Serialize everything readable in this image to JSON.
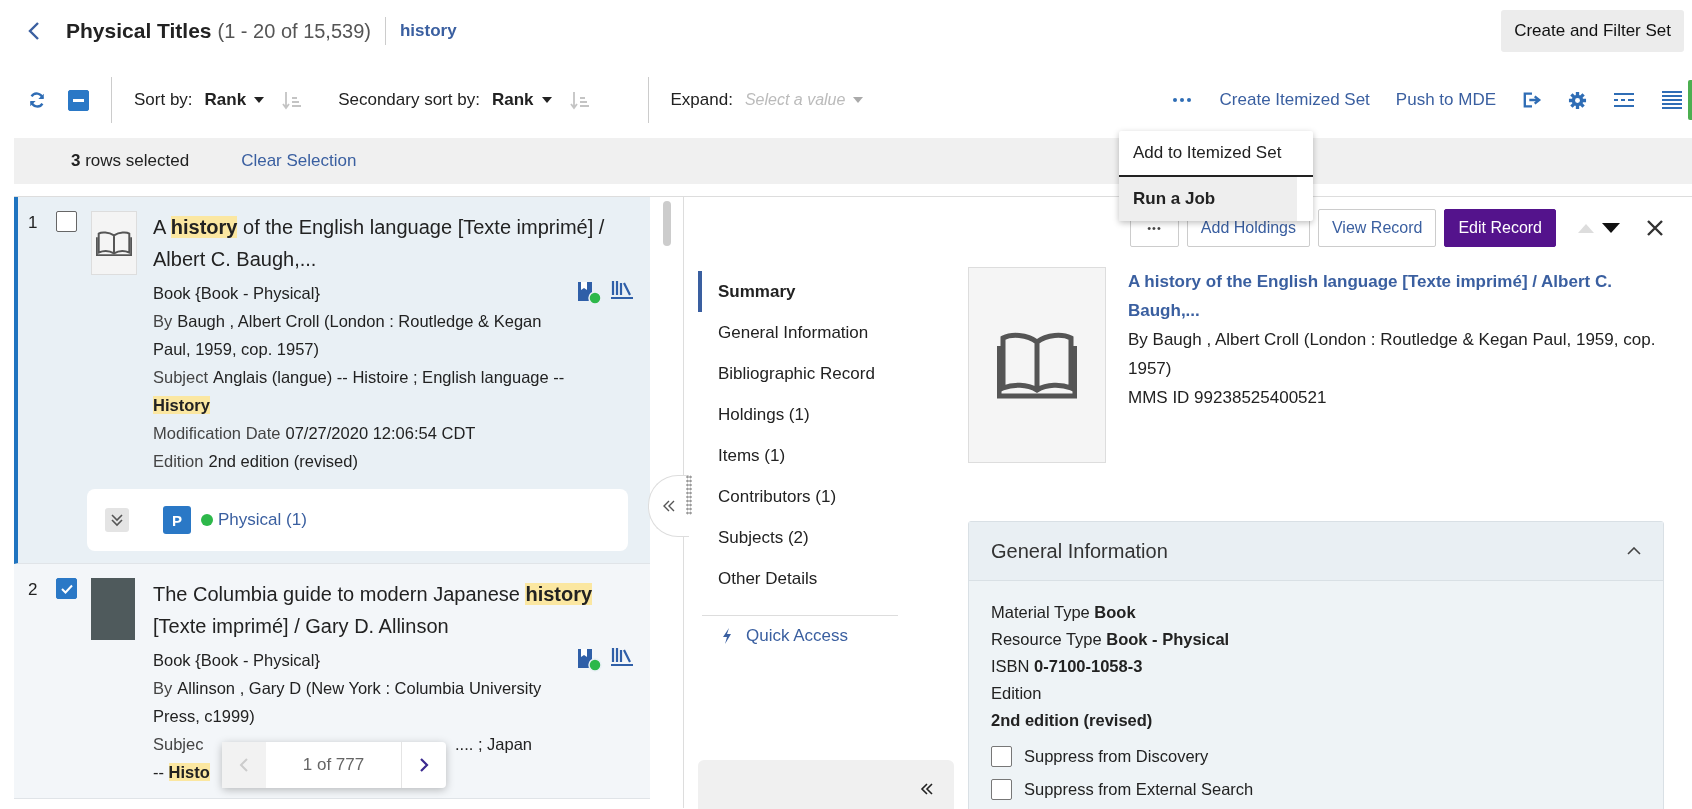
{
  "header": {
    "title": "Physical Titles",
    "count": "(1 - 20 of 15,539)",
    "query": "history",
    "button": "Create and Filter Set"
  },
  "toolbar": {
    "select_all": {
      "indeterminate": true
    },
    "sort": {
      "label": "Sort by:",
      "value": "Rank"
    },
    "secondary_sort": {
      "label": "Secondary sort by:",
      "value": "Rank"
    },
    "expand": {
      "label": "Expand:",
      "placeholder": "Select a value"
    },
    "actions": [
      "Create Itemized Set",
      "Push to MDE"
    ]
  },
  "selection": {
    "count": "3",
    "text": "rows selected",
    "clear": "Clear Selection"
  },
  "menu": [
    {
      "label": "Add to Itemized Set",
      "selected": false
    },
    {
      "label": "Run a Job",
      "selected": true
    }
  ],
  "results": [
    {
      "number": "1",
      "checked": false,
      "current": true,
      "thumbnail": {
        "kind": "icon"
      },
      "title": [
        {
          "text": "A ",
          "highlight": false
        },
        {
          "text": "history",
          "highlight": true
        },
        {
          "text": " of the English language [Texte imprimé] / Albert C. Baugh,...",
          "highlight": false
        }
      ],
      "format": "Book {Book - Physical}",
      "fields": [
        {
          "label": "By",
          "parts": [
            {
              "text": "Baugh , Albert Croll (London : Routledge & Kegan Paul, 1959, cop. 1957)",
              "highlight": false
            }
          ]
        },
        {
          "label": "Subject",
          "parts": [
            {
              "text": "Anglais (langue) -- Histoire ; English language -- ",
              "highlight": false
            },
            {
              "text": "History",
              "highlight": true
            }
          ]
        },
        {
          "label": "Modification Date",
          "parts": [
            {
              "text": "07/27/2020 12:06:54 CDT",
              "highlight": false
            }
          ]
        },
        {
          "label": "Edition",
          "parts": [
            {
              "text": "2nd edition (revised)",
              "highlight": false
            }
          ]
        }
      ],
      "holdings": {
        "badge": "P",
        "link": "Physical (1)",
        "color": "#2db84a"
      }
    },
    {
      "number": "2",
      "checked": true,
      "current": false,
      "thumbnail": {
        "kind": "cover"
      },
      "title": [
        {
          "text": "The Columbia guide to modern Japanese ",
          "highlight": false
        },
        {
          "text": "history",
          "highlight": true
        },
        {
          "text": " [Texte imprimé] / Gary D. Allinson",
          "highlight": false
        }
      ],
      "format": "Book {Book - Physical}",
      "fields": [
        {
          "label": "By",
          "parts": [
            {
              "text": "Allinson , Gary D (New York : Columbia University Press, c1999)",
              "highlight": false
            }
          ]
        }
      ],
      "hidden_lines": [
        {
          "left": "Subjec",
          "right": ".... ; Japan"
        },
        {
          "left": "-- ",
          "highlight": "Histo"
        }
      ]
    }
  ],
  "pager": {
    "text": "1 of 777"
  },
  "record_buttons": [
    {
      "label": "•••",
      "kind": "more"
    },
    {
      "label": "Add Holdings",
      "kind": "outline"
    },
    {
      "label": "View Record",
      "kind": "outline"
    },
    {
      "label": "Edit Record",
      "kind": "primary"
    }
  ],
  "nav": [
    {
      "label": "Summary",
      "selected": true
    },
    {
      "label": "General Information",
      "selected": false
    },
    {
      "label": "Bibliographic Record",
      "selected": false
    },
    {
      "label": "Holdings (1)",
      "selected": false
    },
    {
      "label": "Items (1)",
      "selected": false
    },
    {
      "label": "Contributors (1)",
      "selected": false
    },
    {
      "label": "Subjects (2)",
      "selected": false
    },
    {
      "label": "Other Details",
      "selected": false
    }
  ],
  "quick_access": "Quick Access",
  "record": {
    "title": "A history of the English language [Texte imprimé] / Albert C. Baugh,...",
    "by_label": "By",
    "by_value": "Baugh , Albert Croll (London : Routledge & Kegan Paul, 1959, cop. 1957)",
    "id_label": "MMS ID",
    "id_value": "99238525400521"
  },
  "general": {
    "title": "General Information",
    "expanded": true,
    "fields": [
      {
        "label": "Material Type",
        "value": "Book",
        "kind": "inline"
      },
      {
        "label": "Resource Type",
        "value": "Book - Physical",
        "kind": "inline"
      },
      {
        "label": "ISBN",
        "value": "0-7100-1058-3",
        "kind": "inline"
      },
      {
        "label": "Edition",
        "value": "2nd edition (revised)",
        "kind": "stacked"
      }
    ],
    "checkboxes": [
      {
        "label": "Suppress from Discovery",
        "checked": false
      },
      {
        "label": "Suppress from External Search",
        "checked": false
      }
    ]
  }
}
